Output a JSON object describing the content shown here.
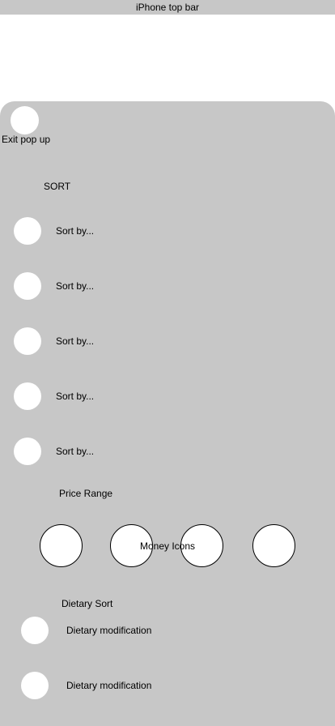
{
  "status_bar": {
    "label": "iPhone top bar"
  },
  "popup": {
    "exit_label": "Exit pop up",
    "sort": {
      "heading": "SORT",
      "options": [
        {
          "label": "Sort by..."
        },
        {
          "label": "Sort by..."
        },
        {
          "label": "Sort by..."
        },
        {
          "label": "Sort by..."
        },
        {
          "label": "Sort by..."
        }
      ]
    },
    "price": {
      "heading": "Price Range",
      "icons_label": "Money Icons"
    },
    "dietary": {
      "heading": "Dietary Sort",
      "options": [
        {
          "label": "Dietary modification"
        },
        {
          "label": "Dietary modification"
        }
      ]
    }
  }
}
